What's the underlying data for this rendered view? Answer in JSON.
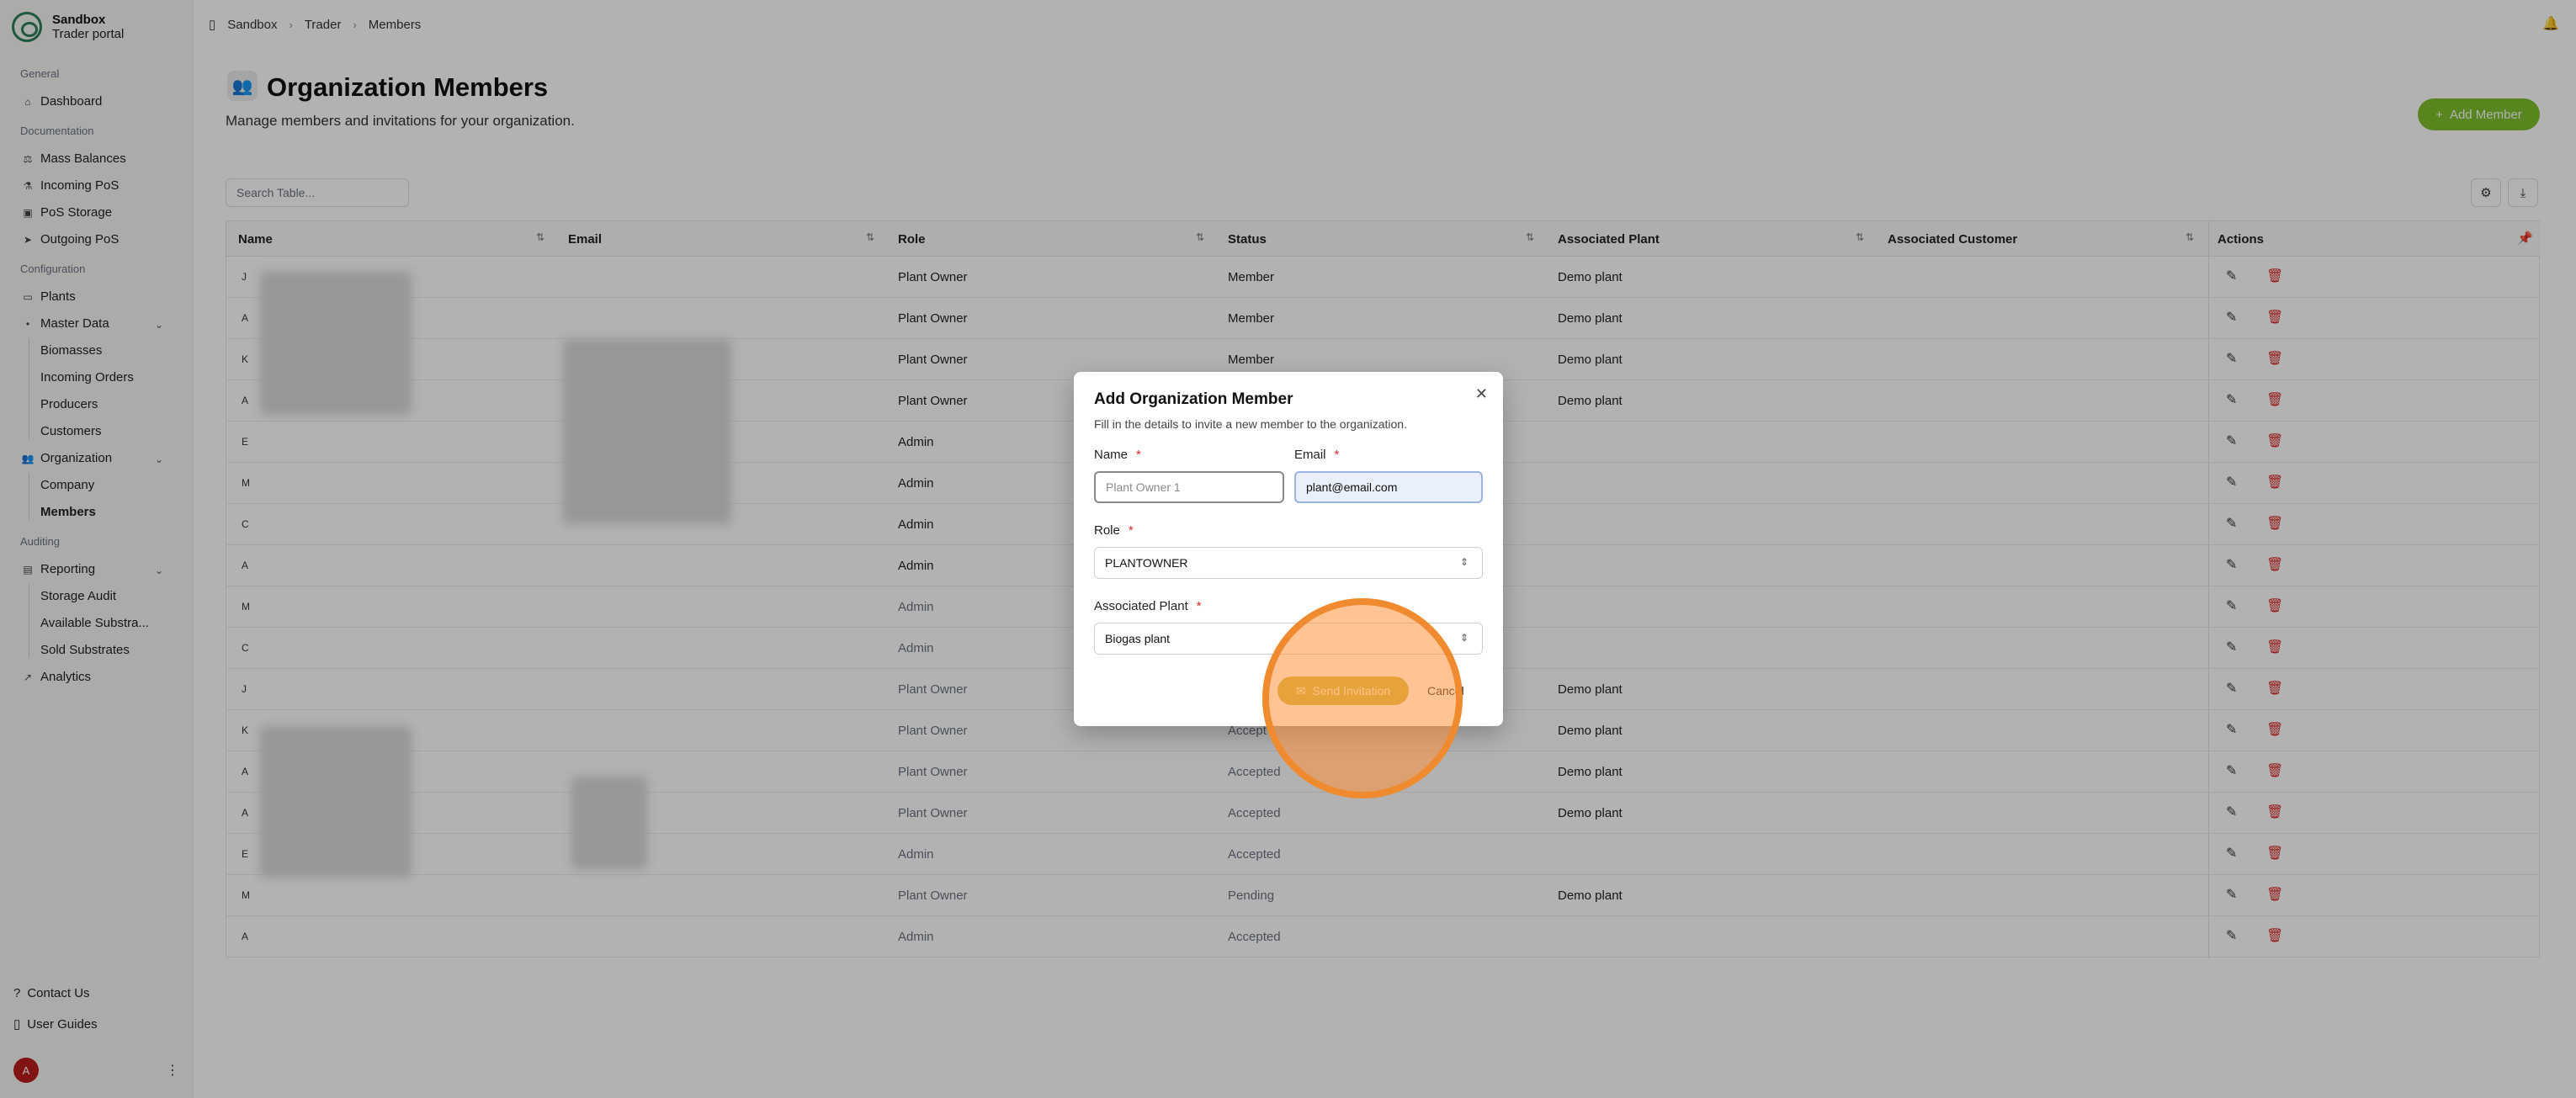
{
  "brand": {
    "title": "Sandbox",
    "subtitle": "Trader portal"
  },
  "sidebar": {
    "sections": {
      "general": "General",
      "documentation": "Documentation",
      "configuration": "Configuration",
      "auditing": "Auditing"
    },
    "items": {
      "dashboard": "Dashboard",
      "mass_balances": "Mass Balances",
      "incoming_pos": "Incoming PoS",
      "pos_storage": "PoS Storage",
      "outgoing_pos": "Outgoing PoS",
      "plants": "Plants",
      "master_data": "Master Data",
      "biomasses": "Biomasses",
      "incoming_orders": "Incoming Orders",
      "producers": "Producers",
      "customers": "Customers",
      "organization": "Organization",
      "company": "Company",
      "members": "Members",
      "reporting": "Reporting",
      "storage_audit": "Storage Audit",
      "available_substrates": "Available Substra...",
      "sold_substrates": "Sold Substrates",
      "analytics": "Analytics"
    },
    "footer": {
      "contact": "Contact Us",
      "guides": "User Guides",
      "avatar": "A"
    }
  },
  "breadcrumb": [
    "Sandbox",
    "Trader",
    "Members"
  ],
  "page": {
    "title": "Organization Members",
    "subtitle": "Manage members and invitations for your organization.",
    "add_button": "Add Member",
    "search_placeholder": "Search Table..."
  },
  "table": {
    "headers": {
      "name": "Name",
      "email": "Email",
      "role": "Role",
      "status": "Status",
      "plant": "Associated Plant",
      "customer": "Associated Customer",
      "actions": "Actions"
    },
    "rows": [
      {
        "initial": "J",
        "role": "Plant Owner",
        "status": "Member",
        "plant": "Demo plant"
      },
      {
        "initial": "A",
        "role": "Plant Owner",
        "status": "Member",
        "plant": "Demo plant"
      },
      {
        "initial": "K",
        "role": "Plant Owner",
        "status": "Member",
        "plant": "Demo plant"
      },
      {
        "initial": "A",
        "role": "Plant Owner",
        "status": "Member",
        "plant": "Demo plant"
      },
      {
        "initial": "E",
        "role": "Admin",
        "status": "",
        "plant": ""
      },
      {
        "initial": "M",
        "role": "Admin",
        "status": "",
        "plant": ""
      },
      {
        "initial": "C",
        "role": "Admin",
        "status": "",
        "plant": ""
      },
      {
        "initial": "A",
        "role": "Admin",
        "status": "",
        "plant": ""
      },
      {
        "initial": "M",
        "role": "Admin",
        "status": "",
        "plant": ""
      },
      {
        "initial": "C",
        "role": "Admin",
        "status": "",
        "plant": ""
      },
      {
        "initial": "J",
        "role": "Plant Owner",
        "status": "",
        "plant": "Demo plant"
      },
      {
        "initial": "K",
        "role": "Plant Owner",
        "status": "Accept",
        "plant": "Demo plant"
      },
      {
        "initial": "A",
        "role": "Plant Owner",
        "status": "Accepted",
        "plant": "Demo plant"
      },
      {
        "initial": "A",
        "role": "Plant Owner",
        "status": "Accepted",
        "plant": "Demo plant"
      },
      {
        "initial": "E",
        "role": "Admin",
        "status": "Accepted",
        "plant": ""
      },
      {
        "initial": "M",
        "role": "Plant Owner",
        "status": "Pending",
        "plant": "Demo plant"
      },
      {
        "initial": "A",
        "role": "Admin",
        "status": "Accepted",
        "plant": ""
      }
    ]
  },
  "modal": {
    "title": "Add Organization Member",
    "description": "Fill in the details to invite a new member to the organization.",
    "name_label": "Name",
    "name_placeholder": "Plant Owner 1",
    "email_label": "Email",
    "email_value": "plant@email.com",
    "role_label": "Role",
    "role_value": "PLANTOWNER",
    "plant_label": "Associated Plant",
    "plant_value": "Biogas plant",
    "send_label": "Send Invitation",
    "cancel_label": "Cancel",
    "required_mark": "*"
  },
  "colors": {
    "accent": "#7fbf2a",
    "danger": "#dc2626",
    "highlight": "#f08a2e"
  }
}
